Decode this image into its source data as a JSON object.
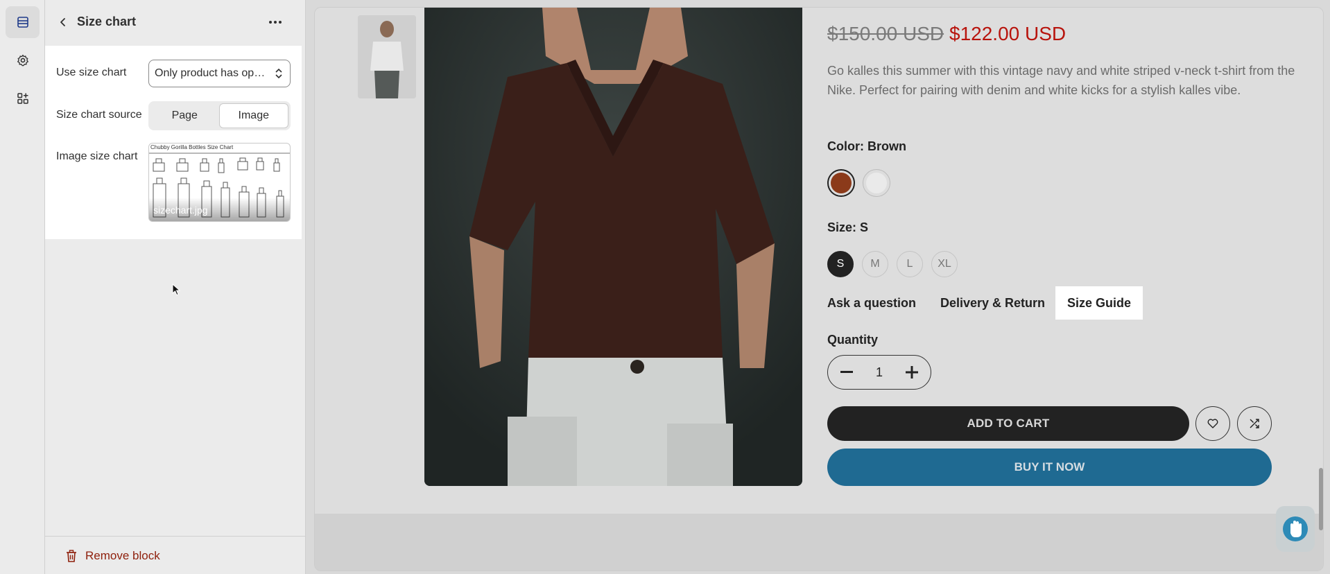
{
  "rail": {
    "items": [
      {
        "icon": "sections-icon",
        "active": true
      },
      {
        "icon": "gear-icon",
        "active": false
      },
      {
        "icon": "apps-icon",
        "active": false
      }
    ]
  },
  "panel": {
    "title": "Size chart",
    "use_size_chart": {
      "label": "Use size chart",
      "value": "Only product has option size"
    },
    "source": {
      "label": "Size chart source",
      "options": [
        "Page",
        "Image"
      ],
      "selected": "Image"
    },
    "image": {
      "label": "Image size chart",
      "caption": "Chubby Gorilla Bottles Size Chart",
      "filename": "sizechart.jpg"
    },
    "remove_label": "Remove block"
  },
  "product": {
    "price_old": "$150.00 USD",
    "price_new": "$122.00 USD",
    "description": "Go kalles this summer with this vintage navy and white striped v-neck t-shirt from the Nike. Perfect for pairing with denim and white kicks for a stylish kalles vibe.",
    "color_label": "Color: Brown",
    "colors": [
      "#8b3a1a",
      "#f2f2f2"
    ],
    "size_label": "Size: S",
    "sizes": [
      "S",
      "M",
      "L",
      "XL"
    ],
    "selected_size": "S",
    "links": {
      "ask": "Ask a question",
      "delivery": "Delivery & Return",
      "size_guide": "Size Guide"
    },
    "quantity_label": "Quantity",
    "quantity": "1",
    "add_to_cart": "ADD TO CART",
    "buy_now": "BUY IT NOW"
  },
  "colors": {
    "sale_price": "#b8140d",
    "remove_red": "#8e1f0b",
    "buy_blue": "#1f6a92"
  }
}
